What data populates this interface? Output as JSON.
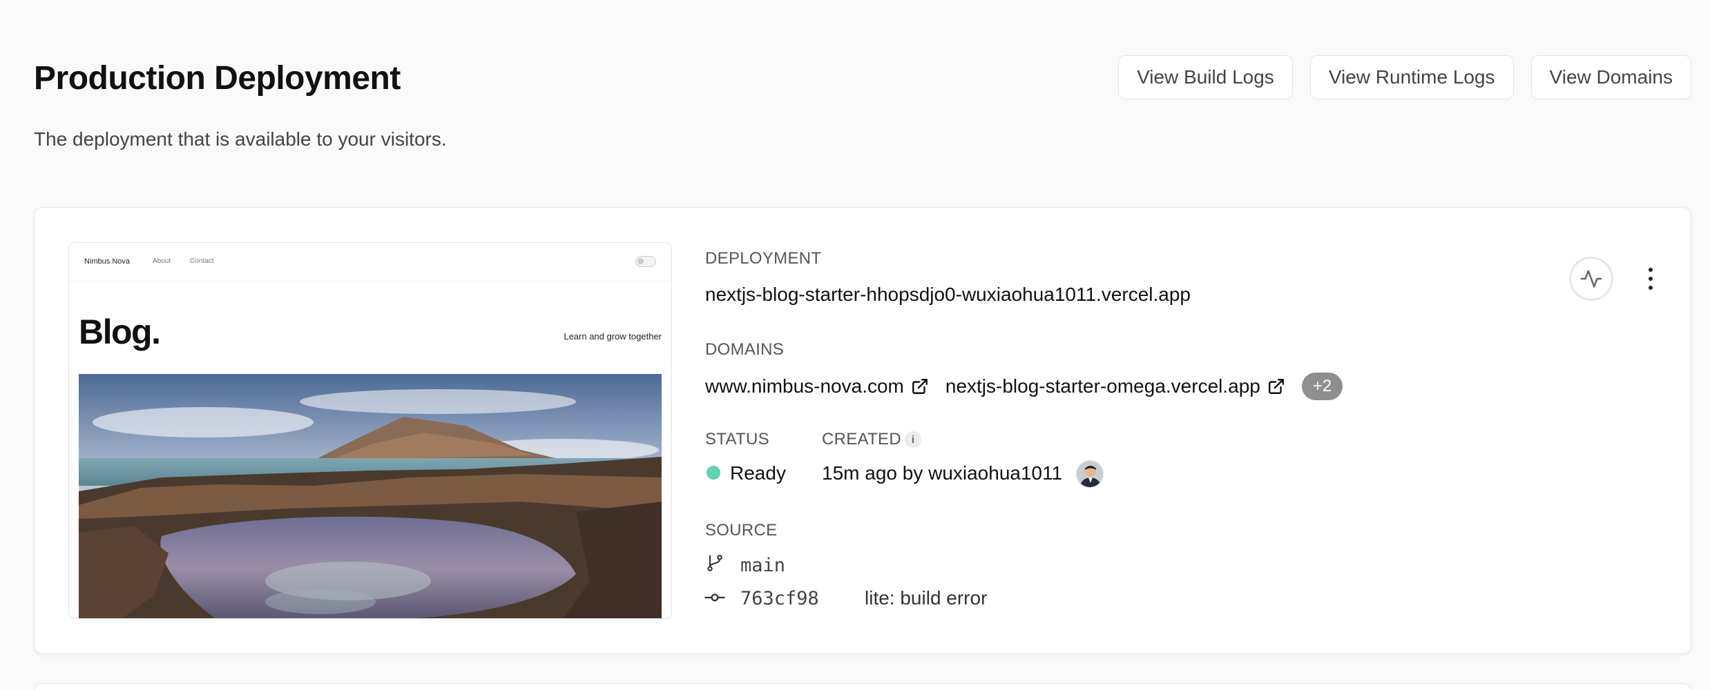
{
  "header": {
    "title": "Production Deployment",
    "subtitle": "The deployment that is available to your visitors.",
    "actions": [
      "View Build Logs",
      "View Runtime Logs",
      "View Domains"
    ]
  },
  "preview": {
    "brand": "Nimbus Nova",
    "nav_links": [
      "About",
      "Contact"
    ],
    "heading": "Blog.",
    "tagline": "Learn and grow together"
  },
  "deployment": {
    "label": "DEPLOYMENT",
    "url": "nextjs-blog-starter-hhopsdjo0-wuxiaohua1011.vercel.app"
  },
  "domains": {
    "label": "DOMAINS",
    "items": [
      "www.nimbus-nova.com",
      "nextjs-blog-starter-omega.vercel.app"
    ],
    "more": "+2"
  },
  "status": {
    "label": "STATUS",
    "value": "Ready",
    "color": "#5fd4b3"
  },
  "created": {
    "label": "CREATED",
    "info_icon": "i",
    "value": "15m ago by wuxiaohua1011"
  },
  "source": {
    "label": "SOURCE",
    "branch": "main",
    "commit_hash": "763cf98",
    "commit_message": "lite: build error"
  },
  "icons": {
    "external_link": "external-link-icon",
    "branch": "git-branch-icon",
    "commit": "git-commit-icon",
    "activity": "activity-icon",
    "menu": "more-vertical-icon"
  }
}
